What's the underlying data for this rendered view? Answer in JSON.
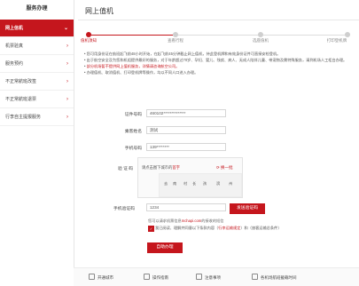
{
  "sidebar": {
    "title": "服务办理",
    "items": [
      {
        "label": "网上信机"
      },
      {
        "label": "机票验真"
      },
      {
        "label": "服务预约"
      },
      {
        "label": "不正常航班改签"
      },
      {
        "label": "不正常航班退票"
      },
      {
        "label": "行李自主提报服务"
      }
    ]
  },
  "header": {
    "title": "网上值机"
  },
  "steps": [
    {
      "label": "值机须知"
    },
    {
      "label": "查看行程"
    },
    {
      "label": "选座值机"
    },
    {
      "label": "打印登机牌"
    }
  ],
  "notes": [
    "您可用身份证在航班起飞前48小时开始，在起飞前45分钟截止网上值机，持此登机牌和有效身份证件可直接安检登机。",
    "出于航空安全及为您和机组提供最好的服务，对于年龄超过70岁、孕妇、婴儿、残疾、病人、无成人陪伴儿童、带宠物及需特殊服务，请到机场人工柜台办理。",
    "部分机场暂不提供网上值机服务，详情请咨询航空公司。",
    "办理值机、取消值机、打印登机牌等操作，均以不同人口进入办理。"
  ],
  "form": {
    "id_label": "证件号码",
    "id_value": "460102**************",
    "name_label": "乘客姓名",
    "name_value": "测试",
    "phone_label": "手机号码",
    "phone_value": "139********",
    "captcha_label": "验 证 码",
    "captcha_tip_prefix": "请点击图下城市的",
    "captcha_tip_hl": "首字",
    "captcha_refresh": "换一批",
    "captcha_chars": [
      "去",
      "南",
      "村",
      "长",
      "孩",
      "滨",
      "州"
    ],
    "sms_label": "手机验证码",
    "sms_value": "1234",
    "sms_button": "发送验证码",
    "hint_prefix": "您可以请求机票信息",
    "hint_hl": "mchapi.com",
    "hint_suffix": "的接收的短信",
    "agree_prefix": "我已阅读、理解并同意以下条款内容（",
    "agree_hl": "行李运输规定",
    "agree_suffix": "）和（旅客运输总条件）",
    "submit": "自助办理"
  },
  "footer": [
    {
      "label": "开通城市"
    },
    {
      "label": "操作指南"
    },
    {
      "label": "注意事项"
    },
    {
      "label": "各机场航班截载时间"
    }
  ],
  "colors": {
    "accent": "#c5161d",
    "check": "✓"
  }
}
